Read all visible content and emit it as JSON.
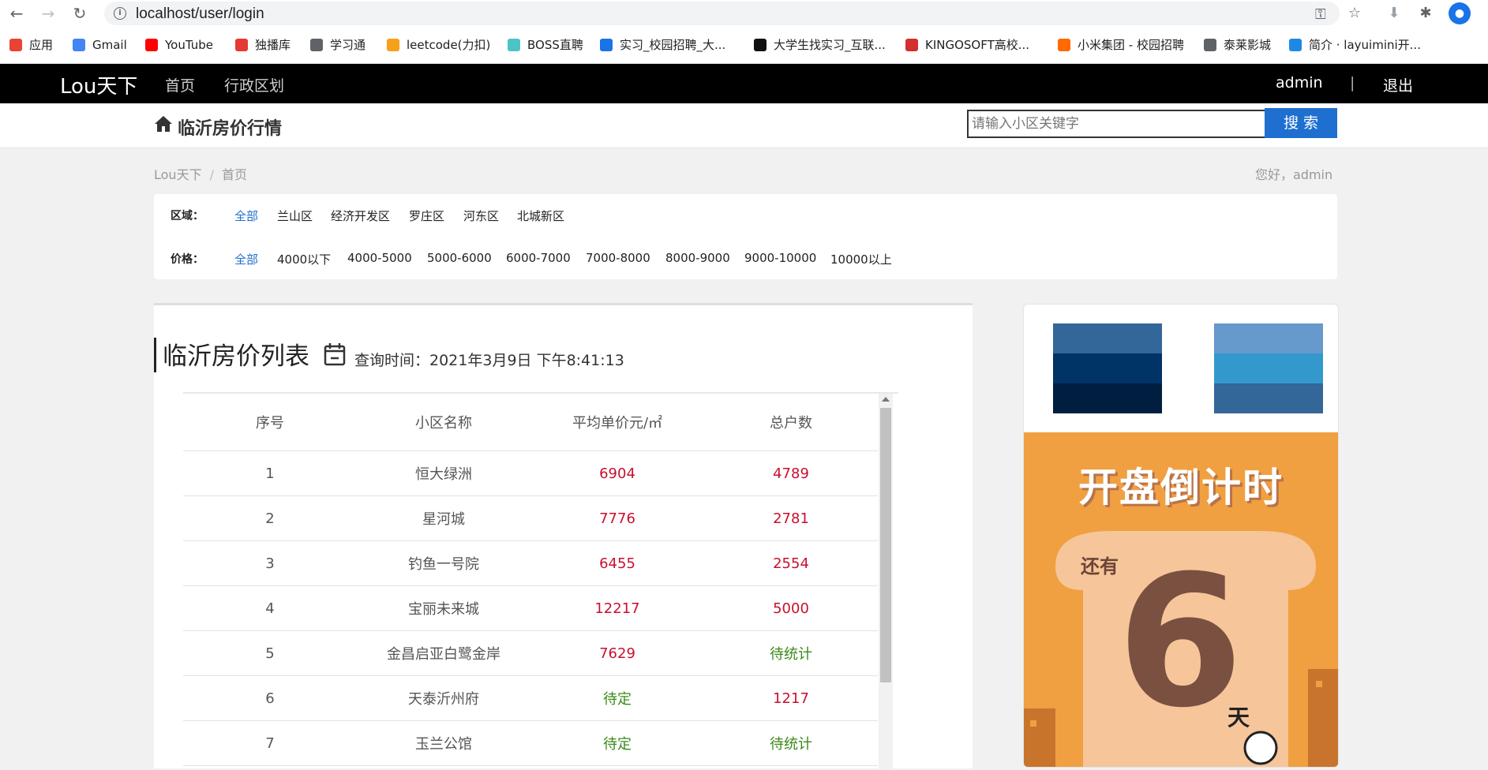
{
  "browser": {
    "url": "localhost/user/login",
    "bookmarks": [
      {
        "label": "应用",
        "icon": "apps-grid-icon",
        "color": "#ea4335"
      },
      {
        "label": "Gmail",
        "icon": "google-icon",
        "color": "#4285f4"
      },
      {
        "label": "YouTube",
        "icon": "youtube-icon",
        "color": "#ff0000"
      },
      {
        "label": "独播库",
        "icon": "play-icon",
        "color": "#e53935"
      },
      {
        "label": "学习通",
        "icon": "globe-icon",
        "color": "#5f6368"
      },
      {
        "label": "leetcode(力扣)",
        "icon": "leetcode-icon",
        "color": "#f89f1b"
      },
      {
        "label": "BOSS直聘",
        "icon": "boss-icon",
        "color": "#4cc3c6"
      },
      {
        "label": "实习_校园招聘_大...",
        "icon": "shixi-icon",
        "color": "#1a73e8"
      },
      {
        "label": "大学生找实习_互联...",
        "icon": "ciweishixi-icon",
        "color": "#111111"
      },
      {
        "label": "KINGOSOFT高校...",
        "icon": "kingosoft-icon",
        "color": "#d32f2f"
      },
      {
        "label": "小米集团 - 校园招聘",
        "icon": "xiaomi-icon",
        "color": "#ff6900"
      },
      {
        "label": "泰莱影城",
        "icon": "globe-icon",
        "color": "#5f6368"
      },
      {
        "label": "简介 · layuimini开...",
        "icon": "layuimini-icon",
        "color": "#1e88e5"
      }
    ]
  },
  "nav": {
    "brand": "Lou天下",
    "links": [
      "首页",
      "行政区划"
    ],
    "user": "admin",
    "divider": "|",
    "logout": "退出"
  },
  "subheader": {
    "title": "临沂房价行情",
    "search_placeholder": "请输入小区关键字",
    "search_button": "搜 索"
  },
  "breadcrumb": {
    "items": [
      "Lou天下",
      "首页"
    ],
    "separator": "/",
    "greeting": "您好，admin"
  },
  "filters": {
    "region_label": "区域：",
    "region_options": [
      "全部",
      "兰山区",
      "经济开发区",
      "罗庄区",
      "河东区",
      "北城新区"
    ],
    "price_label": "价格：",
    "price_options": [
      "全部",
      "4000以下",
      "4000-5000",
      "5000-6000",
      "6000-7000",
      "7000-8000",
      "8000-9000",
      "9000-10000",
      "10000以上"
    ],
    "active_color": "#1e6fd0"
  },
  "list": {
    "title": "临沂房价列表",
    "query_label": "查询时间：",
    "query_time": "2021年3月9日 下午8:41:13",
    "columns": [
      "序号",
      "小区名称",
      "平均单价元/㎡",
      "总户数"
    ],
    "rows": [
      {
        "index": "1",
        "name": "恒大绿洲",
        "price": "6904",
        "households": "4789"
      },
      {
        "index": "2",
        "name": "星河城",
        "price": "7776",
        "households": "2781"
      },
      {
        "index": "3",
        "name": "钓鱼一号院",
        "price": "6455",
        "households": "2554"
      },
      {
        "index": "4",
        "name": "宝丽未来城",
        "price": "12217",
        "households": "5000"
      },
      {
        "index": "5",
        "name": "金昌启亚白鹭金岸",
        "price": "7629",
        "households": "待统计"
      },
      {
        "index": "6",
        "name": "天泰沂州府",
        "price": "待定",
        "households": "1217"
      },
      {
        "index": "7",
        "name": "玉兰公馆",
        "price": "待定",
        "households": "待统计"
      }
    ],
    "value_color": "#c8102e",
    "pending_color": "#3a8a19"
  },
  "ad": {
    "swatches_left": [
      "#336699",
      "#003366",
      "#001f40"
    ],
    "swatches_right": [
      "#6699cc",
      "#3399cc",
      "#336699"
    ],
    "poster_title": "开盘倒计时",
    "poster_prefix": "还有",
    "poster_number": "6",
    "poster_unit": "天"
  }
}
